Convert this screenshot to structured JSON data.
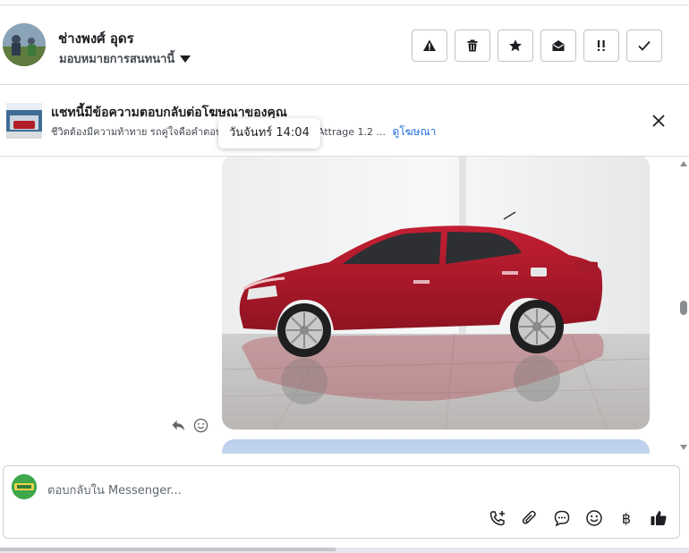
{
  "header": {
    "contact_name": "ช่างพงศ์ อุดร",
    "assign_label": "มอบหมายการสนทนานี้",
    "actions": [
      {
        "name": "report-spam",
        "icon": "warning-icon"
      },
      {
        "name": "delete",
        "icon": "trash-icon"
      },
      {
        "name": "star",
        "icon": "star-icon"
      },
      {
        "name": "mark-unread",
        "icon": "envelope-open-icon"
      },
      {
        "name": "follow-up",
        "icon": "double-exclamation-icon"
      },
      {
        "name": "mark-done",
        "icon": "check-icon"
      }
    ]
  },
  "banner": {
    "title": "แชทนี้มีข้อความตอบกลับต่อโฆษณาของคุณ",
    "subtitle_lead": "ชีวิตต้องมีความท้าทาย รถคู่ใจคือคำตอบ",
    "subtitle_tail": "Attrage 1.2 ...",
    "link": "ดูโฆษณา"
  },
  "tooltip": {
    "timestamp": "วันจันทร์ 14:04"
  },
  "composer": {
    "placeholder": "ตอบกลับใน Messenger...",
    "currency_symbol": "฿"
  },
  "colors": {
    "link": "#216fdb",
    "like": "#1c1e21"
  }
}
